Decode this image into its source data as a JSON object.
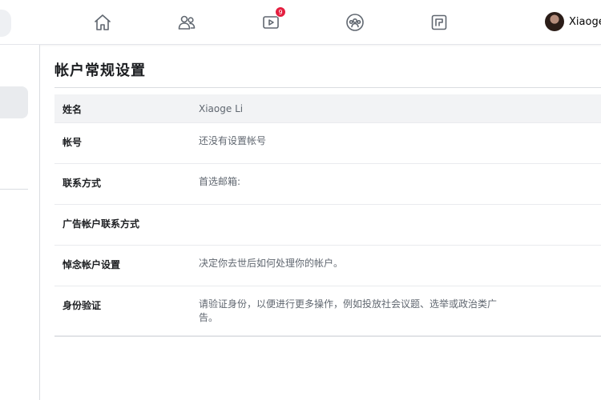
{
  "nav": {
    "icons": [
      "home-icon",
      "friends-icon",
      "watch-icon",
      "groups-icon",
      "gaming-icon"
    ],
    "watch_badge": "9",
    "profile_name": "Xiaoge Li",
    "accent": "#e41e3f"
  },
  "settings": {
    "title": "帐户常规设置",
    "rows": [
      {
        "label": "姓名",
        "value": "Xiaoge Li"
      },
      {
        "label": "帐号",
        "value": "还没有设置帐号"
      },
      {
        "label": "联系方式",
        "value": "首选邮箱:"
      },
      {
        "label": "广告帐户联系方式",
        "value": ""
      },
      {
        "label": "悼念帐户设置",
        "value": "决定你去世后如何处理你的帐户。"
      },
      {
        "label": "身份验证",
        "value": "请验证身份，以便进行更多操作，例如投放社会议题、选举或政治类广告。"
      }
    ]
  }
}
